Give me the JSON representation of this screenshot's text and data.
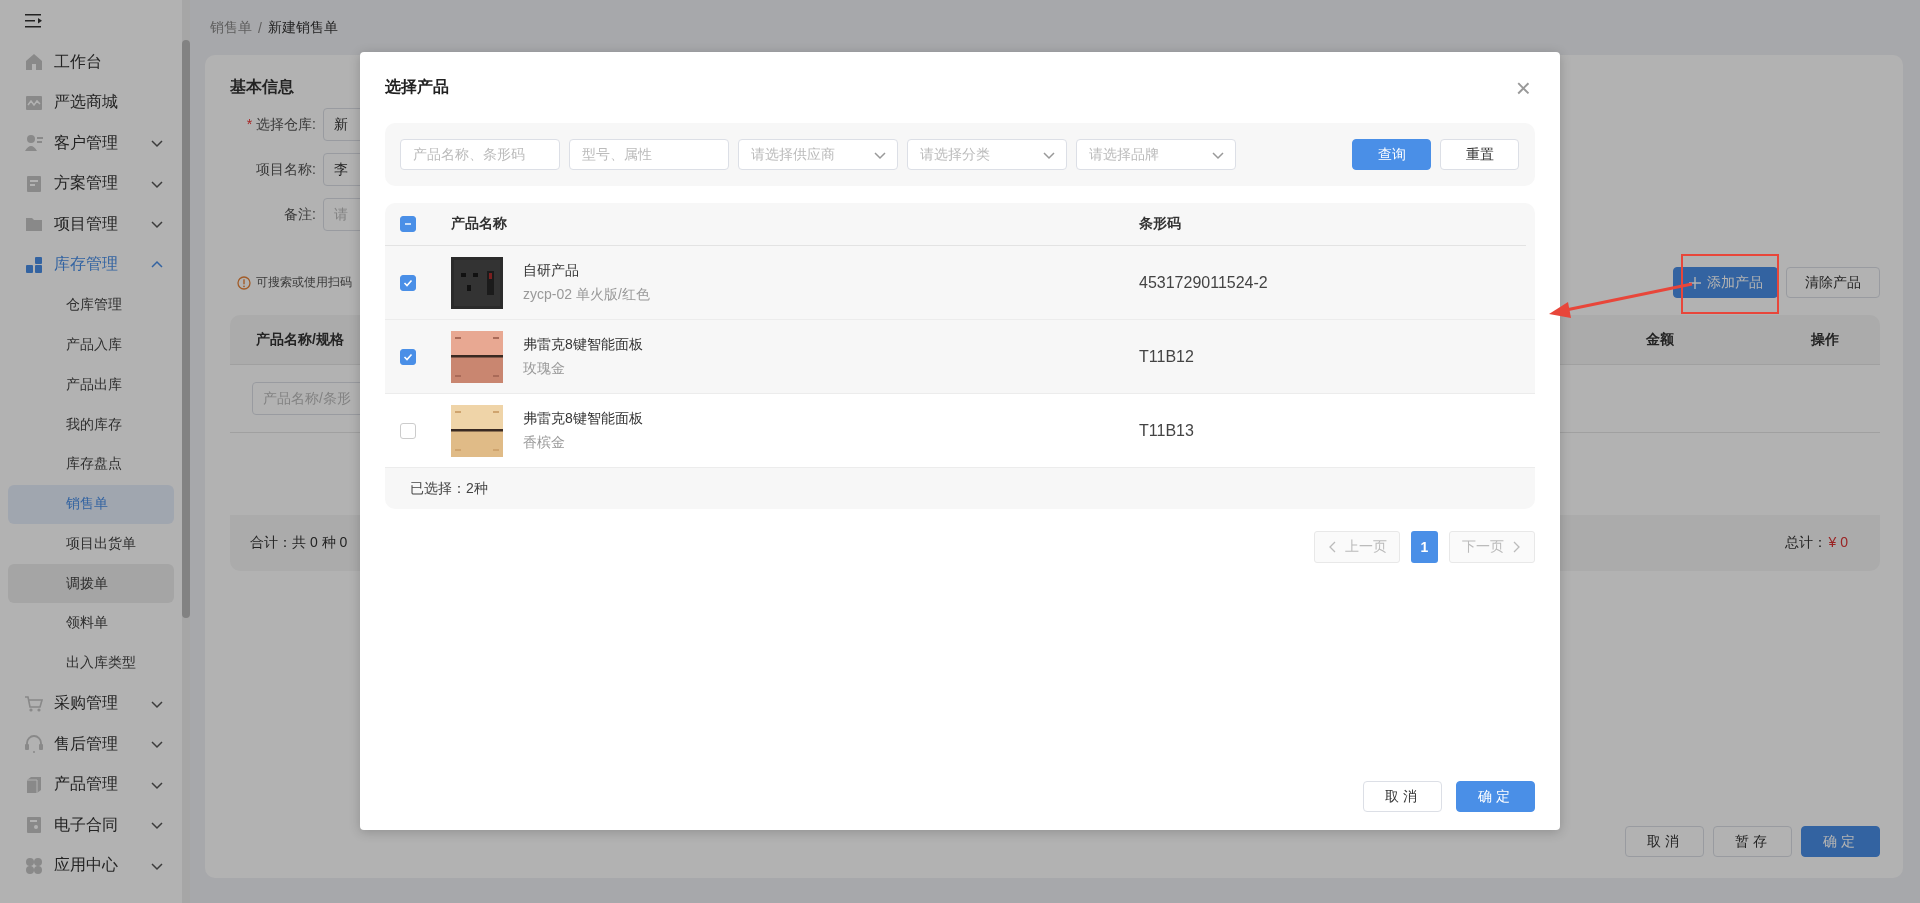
{
  "sidebar": {
    "items": [
      {
        "label": "工作台",
        "active": false
      },
      {
        "label": "严选商城",
        "active": false
      },
      {
        "label": "客户管理",
        "expanded": false,
        "active": false
      },
      {
        "label": "方案管理",
        "expanded": false,
        "active": false
      },
      {
        "label": "项目管理",
        "expanded": false,
        "active": false
      },
      {
        "label": "库存管理",
        "expanded": true,
        "active": true,
        "children": [
          {
            "label": "仓库管理",
            "selected": false,
            "hovered": false
          },
          {
            "label": "产品入库",
            "selected": false,
            "hovered": false
          },
          {
            "label": "产品出库",
            "selected": false,
            "hovered": false
          },
          {
            "label": "我的库存",
            "selected": false,
            "hovered": false
          },
          {
            "label": "库存盘点",
            "selected": false,
            "hovered": false
          },
          {
            "label": "销售单",
            "selected": true,
            "hovered": false
          },
          {
            "label": "项目出货单",
            "selected": false,
            "hovered": false
          },
          {
            "label": "调拨单",
            "selected": false,
            "hovered": true
          },
          {
            "label": "领料单",
            "selected": false,
            "hovered": false
          },
          {
            "label": "出入库类型",
            "selected": false,
            "hovered": false
          }
        ]
      },
      {
        "label": "采购管理",
        "expanded": false,
        "active": false
      },
      {
        "label": "售后管理",
        "expanded": false,
        "active": false
      },
      {
        "label": "产品管理",
        "expanded": false,
        "active": false
      },
      {
        "label": "电子合同",
        "expanded": false,
        "active": false
      },
      {
        "label": "应用中心",
        "expanded": false,
        "active": false
      }
    ]
  },
  "page": {
    "breadcrumb": [
      "销售单",
      "新建销售单"
    ],
    "breadcrumb_separator": "/",
    "section_title": "基本信息",
    "required_mark": "*",
    "fields": [
      {
        "label": "选择仓库:",
        "required": true,
        "value": "新"
      },
      {
        "label": "项目名称:",
        "required": false,
        "value": "李"
      },
      {
        "label": "备注:",
        "required": false,
        "placeholder": "请"
      }
    ],
    "notice": "可搜索或使用扫码",
    "add_button": "添加产品",
    "clear_button": "清除产品",
    "table": {
      "columns": [
        "产品名称/规格",
        "金额",
        "操作"
      ],
      "search_placeholder": "产品名称/条形",
      "summary": "合计：共 0 种 0",
      "total_label": "总计：",
      "total_value": "¥ 0"
    },
    "buttons": [
      {
        "label": "取消",
        "kind": "default"
      },
      {
        "label": "暂存",
        "kind": "default"
      },
      {
        "label": "确定",
        "kind": "primary"
      }
    ]
  },
  "modal": {
    "title": "选择产品",
    "close": "×",
    "filters": [
      {
        "placeholder": "产品名称、条形码",
        "kind": "input"
      },
      {
        "placeholder": "型号、属性",
        "kind": "input"
      },
      {
        "placeholder": "请选择供应商",
        "kind": "select"
      },
      {
        "placeholder": "请选择分类",
        "kind": "select"
      },
      {
        "placeholder": "请选择品牌",
        "kind": "select"
      }
    ],
    "search_button": "查询",
    "reset_button": "重置",
    "table": {
      "columns": [
        "产品名称",
        "条形码"
      ],
      "partially_selected": true,
      "rows": [
        {
          "name": "自研产品",
          "spec": "zycp-02 单火版/红色",
          "barcode": "4531729011524-2",
          "selected": true
        },
        {
          "name": "弗雷克8键智能面板",
          "spec": "玫瑰金",
          "barcode": "T11B12",
          "selected": true
        },
        {
          "name": "弗雷克8键智能面板",
          "spec": "香槟金",
          "barcode": "T11B13",
          "selected": false
        }
      ],
      "footer": "已选择：2种"
    },
    "pagination": {
      "prev": "上一页",
      "next": "下一页",
      "prev_disabled": true,
      "next_disabled": true,
      "pages": [
        {
          "label": "1",
          "selected": true
        }
      ]
    },
    "buttons": [
      {
        "label": "取消",
        "kind": "default"
      },
      {
        "label": "确定",
        "kind": "primary"
      }
    ]
  }
}
